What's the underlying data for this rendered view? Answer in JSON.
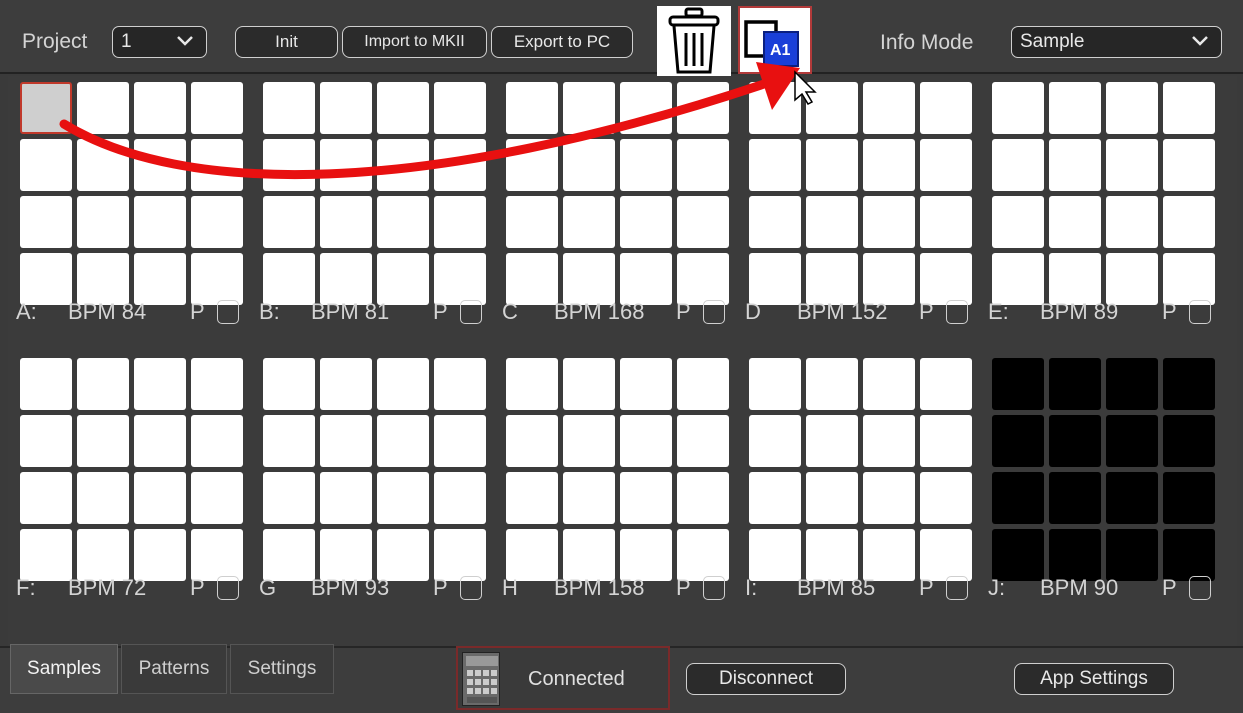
{
  "toolbar": {
    "project_label": "Project",
    "project_value": "1",
    "init_label": "Init",
    "import_label": "Import to MKII",
    "export_label": "Export to PC",
    "info_mode_label": "Info Mode",
    "info_mode_value": "Sample",
    "drag_badge": "A1"
  },
  "banks": [
    {
      "letter": "A:",
      "bpm": "BPM 84",
      "p": "P"
    },
    {
      "letter": "B:",
      "bpm": "BPM 81",
      "p": "P"
    },
    {
      "letter": "C",
      "bpm": "BPM 168",
      "p": "P"
    },
    {
      "letter": "D",
      "bpm": "BPM 152",
      "p": "P"
    },
    {
      "letter": "E:",
      "bpm": "BPM 89",
      "p": "P"
    },
    {
      "letter": "F:",
      "bpm": "BPM 72",
      "p": "P"
    },
    {
      "letter": "G",
      "bpm": "BPM 93",
      "p": "P"
    },
    {
      "letter": "H",
      "bpm": "BPM 158",
      "p": "P"
    },
    {
      "letter": "I:",
      "bpm": "BPM 85",
      "p": "P"
    },
    {
      "letter": "J:",
      "bpm": "BPM 90",
      "p": "P"
    }
  ],
  "tabs": [
    "Samples",
    "Patterns",
    "Settings"
  ],
  "device": {
    "status": "Connected"
  },
  "disconnect_label": "Disconnect",
  "app_settings_label": "App Settings",
  "colors": {
    "arrow": "#e81010",
    "badge": "#1a3fd8"
  }
}
